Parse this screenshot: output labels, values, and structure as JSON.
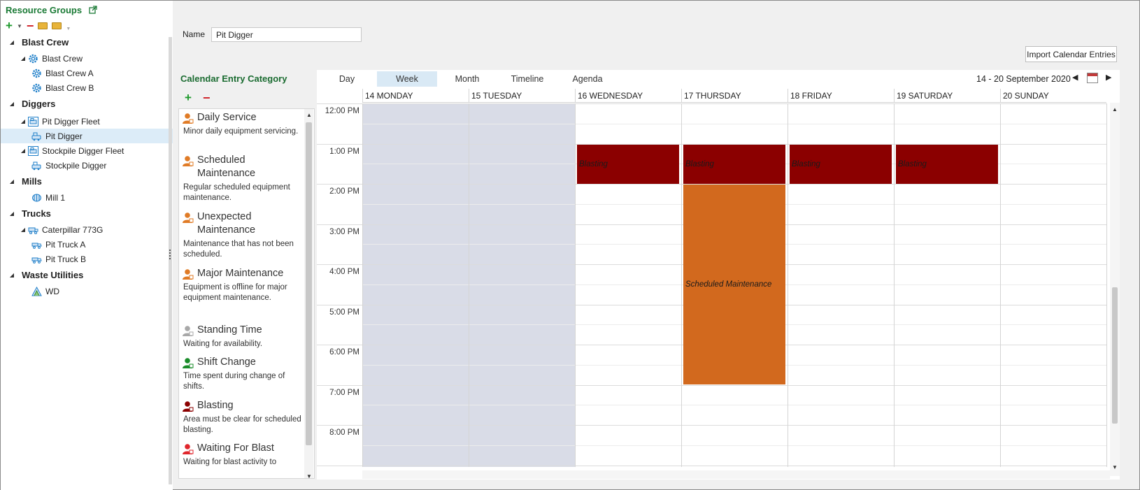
{
  "left_panel": {
    "title": "Resource Groups",
    "tree": [
      {
        "label": "Blast Crew",
        "type": "group"
      },
      {
        "label": "Blast Crew",
        "type": "parent",
        "icon": "gear-icon"
      },
      {
        "label": "Blast Crew A",
        "type": "child",
        "icon": "gear-icon"
      },
      {
        "label": "Blast Crew B",
        "type": "child",
        "icon": "gear-icon"
      },
      {
        "label": "Diggers",
        "type": "group"
      },
      {
        "label": "Pit Digger Fleet",
        "type": "parent",
        "icon": "digger-fleet-icon"
      },
      {
        "label": "Pit Digger",
        "type": "child",
        "icon": "digger-icon",
        "selected": true
      },
      {
        "label": "Stockpile Digger Fleet",
        "type": "parent",
        "icon": "digger-fleet-icon"
      },
      {
        "label": "Stockpile Digger",
        "type": "child",
        "icon": "digger-icon"
      },
      {
        "label": "Mills",
        "type": "group"
      },
      {
        "label": "Mill 1",
        "type": "child-shallow",
        "icon": "mill-icon"
      },
      {
        "label": "Trucks",
        "type": "group"
      },
      {
        "label": "Caterpillar 773G",
        "type": "parent",
        "icon": "truck-fleet-icon"
      },
      {
        "label": "Pit Truck A",
        "type": "child",
        "icon": "truck-icon"
      },
      {
        "label": "Pit Truck B",
        "type": "child",
        "icon": "truck-icon"
      },
      {
        "label": "Waste Utilities",
        "type": "group"
      },
      {
        "label": "WD",
        "type": "child-shallow",
        "icon": "waste-icon"
      }
    ]
  },
  "form": {
    "name_label": "Name",
    "name_value": "Pit Digger",
    "import_label": "Import Calendar Entries"
  },
  "categories": {
    "title": "Calendar Entry Category",
    "items": [
      {
        "name": "Daily Service",
        "desc": "Minor daily equipment servicing.",
        "color": "#e07b26"
      },
      {
        "name": "Scheduled Maintenance",
        "desc": "Regular scheduled equipment maintenance.",
        "color": "#e07b26"
      },
      {
        "name": "Unexpected Maintenance",
        "desc": "Maintenance that has not been scheduled.",
        "color": "#e07b26"
      },
      {
        "name": "Major Maintenance",
        "desc": "Equipment is offline for major equipment maintenance.",
        "color": "#e07b26"
      },
      {
        "name": "Standing Time",
        "desc": "Waiting for availability.",
        "color": "#a8a8a8"
      },
      {
        "name": "Shift Change",
        "desc": "Time spent during change of shifts.",
        "color": "#1a8c2a"
      },
      {
        "name": "Blasting",
        "desc": "Area must be clear for scheduled blasting.",
        "color": "#8b0000"
      },
      {
        "name": "Waiting For Blast",
        "desc": "Waiting for blast activity to",
        "color": "#e0262c"
      }
    ]
  },
  "scheduler": {
    "views": [
      "Day",
      "Week",
      "Month",
      "Timeline",
      "Agenda"
    ],
    "active_view": "Week",
    "range": "14  - 20 September 2020",
    "days": [
      "14 MONDAY",
      "15 TUESDAY",
      "16 WEDNESDAY",
      "17 THURSDAY",
      "18 FRIDAY",
      "19 SATURDAY",
      "20 SUNDAY"
    ],
    "times": [
      "12:00 PM",
      "1:00 PM",
      "2:00 PM",
      "3:00 PM",
      "4:00 PM",
      "5:00 PM",
      "6:00 PM",
      "7:00 PM",
      "8:00 PM"
    ],
    "shaded_days": [
      0,
      1
    ],
    "events": [
      {
        "title": "Blasting",
        "day": 2,
        "start": 1,
        "end": 2,
        "category": "blast"
      },
      {
        "title": "Blasting",
        "day": 3,
        "start": 1,
        "end": 2,
        "category": "blast"
      },
      {
        "title": "Blasting",
        "day": 4,
        "start": 1,
        "end": 2,
        "category": "blast"
      },
      {
        "title": "Blasting",
        "day": 5,
        "start": 1,
        "end": 2,
        "category": "blast"
      },
      {
        "title": "Scheduled Maintenance",
        "day": 3,
        "start": 2,
        "end": 7,
        "category": "maint"
      }
    ]
  }
}
